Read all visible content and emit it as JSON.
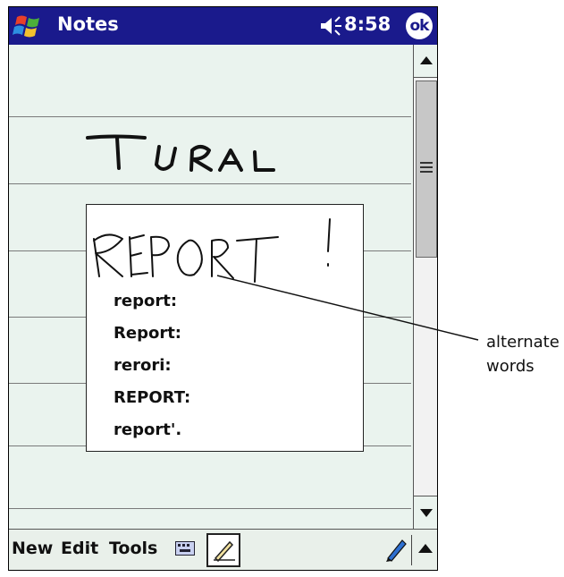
{
  "titlebar": {
    "app_title": "Notes",
    "clock": "8:58",
    "ok_label": "ok",
    "color": "#1a1a8c"
  },
  "popup": {
    "alternates": [
      "report:",
      "Report:",
      "rerori:",
      "REPORT:",
      "report'."
    ]
  },
  "menubar": {
    "new_label": "New",
    "edit_label": "Edit",
    "tools_label": "Tools",
    "icons": [
      "keyboard-icon",
      "pen-icon",
      "input-pen-icon",
      "input-panel-arrow-icon"
    ]
  },
  "callout": {
    "line1": "alternate",
    "line2": "words"
  }
}
